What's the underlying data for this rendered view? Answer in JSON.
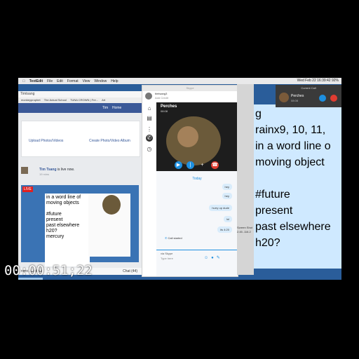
{
  "menubar": {
    "app": "TextEdit",
    "items": [
      "File",
      "Edit",
      "Format",
      "View",
      "Window",
      "Help"
    ],
    "status": "Wed Feb 22  16:39:42  92%"
  },
  "facebook": {
    "address": "Timtsang",
    "bookmarks": [
      "monkeyprophet",
      "The Actual School",
      "TUNA CROWN | Fre...",
      "Art"
    ],
    "nav_user": "Tim",
    "nav_home": "Home",
    "upload_label": "Upload Photos/Videos",
    "create_album_label": "Create Photo/Video Album",
    "post_author": "Tim Tsang",
    "post_status": "is live now.",
    "post_time": "19 mins",
    "live_badge": "LIVE",
    "inner_note": [
      "in a word line of",
      "moving objects",
      "",
      "#future",
      "present",
      "past elsewhere",
      "h20?",
      "mercury"
    ],
    "bottom_bar": "Chat (44)",
    "bottom_name": "ndro Azzolina"
  },
  "skype": {
    "title": "Skype",
    "user": "timtsang3",
    "user_status": "Add Credit",
    "contact": "Perches",
    "call_time": "08:08",
    "today": "Today",
    "messages": [
      "hey",
      "hurry up dude",
      "lol",
      "its 4:20"
    ],
    "call_started": "Call started",
    "type_here": "Type here",
    "typed": "via Skype",
    "colors": {
      "accent": "#1d8fe0",
      "hangup": "#e03c31"
    }
  },
  "current_call": {
    "header": "Current Call",
    "name": "Perches",
    "time": "08:08"
  },
  "note_lines": [
    "g",
    "rainx9, 10, 11,",
    "in a word line o",
    "moving object",
    "",
    "#future",
    "present",
    "past elsewhere",
    "h20?"
  ],
  "side_text": [
    "Screen Shot",
    "2.45..116.2"
  ],
  "timecode": "00:00:51;22"
}
